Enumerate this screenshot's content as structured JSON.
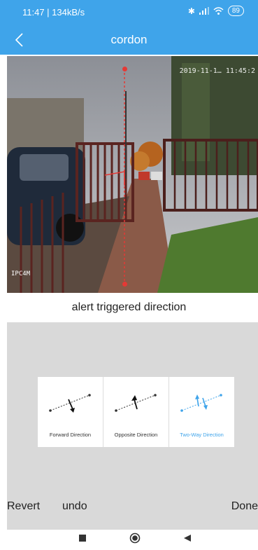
{
  "status": {
    "time_speed": "11:47 | 134kB/s",
    "battery": "89"
  },
  "header": {
    "title": "cordon",
    "back_icon": "chevron-left-icon"
  },
  "camera": {
    "timestamp": "2019-11-1… 11:45:2",
    "label": "IPC4M"
  },
  "section": {
    "title": "alert triggered direction"
  },
  "directions": [
    {
      "label": "Forward Direction",
      "icon": "forward-direction-icon",
      "selected": false
    },
    {
      "label": "Opposite Direction",
      "icon": "opposite-direction-icon",
      "selected": false
    },
    {
      "label": "Two-Way Direction",
      "icon": "two-way-direction-icon",
      "selected": true
    }
  ],
  "buttons": {
    "revert": "Revert",
    "undo": "undo",
    "done": "Done"
  },
  "colors": {
    "accent": "#3fa4ea",
    "line": "#e53935",
    "panel": "#d9d9d9"
  }
}
